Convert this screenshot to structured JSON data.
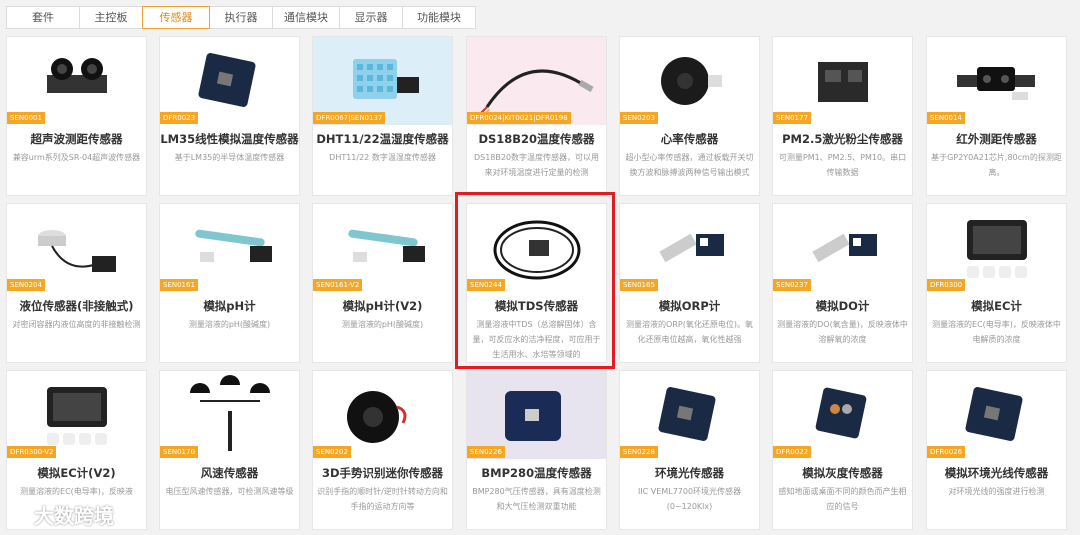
{
  "tabs": [
    {
      "label": "套件",
      "active": false
    },
    {
      "label": "主控板",
      "active": false
    },
    {
      "label": "传感器",
      "active": true
    },
    {
      "label": "执行器",
      "active": false
    },
    {
      "label": "通信模块",
      "active": false
    },
    {
      "label": "显示器",
      "active": false
    },
    {
      "label": "功能模块",
      "active": false
    }
  ],
  "colors": {
    "accent": "#f5a623",
    "highlight": "#e31b23"
  },
  "products": [
    {
      "sku": "SEN0001",
      "title": "超声波测距传感器",
      "desc": "兼容urm系列及SR-04超声波传感器",
      "icon": "ultrasonic-sensor-icon"
    },
    {
      "sku": "DFR0023",
      "title": "LM35线性模拟温度传感器",
      "desc": "基于LM35的半导体温度传感器",
      "icon": "temperature-module-icon"
    },
    {
      "sku": "DFR0067|SEN0137",
      "title": "DHT11/22温湿度传感器",
      "desc": "DHT11/22 数字温湿度传感器",
      "icon": "humidity-sensor-icon"
    },
    {
      "sku": "DFR0024|KIT0021|DFR0198",
      "title": "DS18B20温度传感器",
      "desc": "DS18B20数字温度传感器，可以用来对环境温度进行定量的检测",
      "icon": "probe-cable-icon"
    },
    {
      "sku": "SEN0203",
      "title": "心率传感器",
      "desc": "超小型心率传感器，通过板载开关切换方波和脉搏波两种信号输出模式",
      "icon": "heart-rate-sensor-icon"
    },
    {
      "sku": "SEN0177",
      "title": "PM2.5激光粉尘传感器",
      "desc": "可测量PM1、PM2.5、PM10。串口传输数据",
      "icon": "dust-sensor-icon"
    },
    {
      "sku": "SEN0014",
      "title": "红外测距传感器",
      "desc": "基于GP2Y0A21芯片,80cm的探测距离。",
      "icon": "ir-distance-sensor-icon"
    },
    {
      "sku": "SEN0204",
      "title": "液位传感器(非接触式)",
      "desc": "对密闭容器内液位高度的非接触检测",
      "icon": "liquid-level-sensor-icon"
    },
    {
      "sku": "SEN0161",
      "title": "模拟pH计",
      "desc": "测量溶液的pH(酸碱度)",
      "icon": "ph-probe-icon"
    },
    {
      "sku": "SEN0161-V2",
      "title": "模拟pH计(V2)",
      "desc": "测量溶液的pH(酸碱度)",
      "icon": "ph-probe-v2-icon"
    },
    {
      "sku": "SEN0244",
      "title": "模拟TDS传感器",
      "desc": "测量溶液中TDS（总溶解固体）含量，可反应水的洁净程度，可应用于生活用水、水培等领域的",
      "icon": "tds-probe-icon"
    },
    {
      "sku": "SEN0165",
      "title": "模拟ORP计",
      "desc": "测量溶液的ORP(氧化还原电位)。氧化还原电位越高，氧化性越强",
      "icon": "orp-probe-icon"
    },
    {
      "sku": "SEN0237",
      "title": "模拟DO计",
      "desc": "测量溶液的DO(氧含量)，反映液体中溶解氧的浓度",
      "icon": "do-probe-icon"
    },
    {
      "sku": "DFR0300",
      "title": "模拟EC计",
      "desc": "测量溶液的EC(电导率)，反映液体中电解质的浓度",
      "icon": "ec-meter-kit-icon"
    },
    {
      "sku": "DFR0300-V2",
      "title": "模拟EC计(V2)",
      "desc": "测量溶液的EC(电导率)，反映液",
      "icon": "ec-meter-kit-v2-icon"
    },
    {
      "sku": "SEN0170",
      "title": "风速传感器",
      "desc": "电压型风速传感器，可检测风速等级",
      "icon": "anemometer-icon"
    },
    {
      "sku": "SEN0202",
      "title": "3D手势识别迷你传感器",
      "desc": "识别手指的顺时针/逆时针转动方向和手指的运动方向等",
      "icon": "gesture-sensor-icon"
    },
    {
      "sku": "SEN0226",
      "title": "BMP280温度传感器",
      "desc": "BMP280气压传感器，具有温度检测和大气压检测双重功能",
      "icon": "bmp280-board-icon"
    },
    {
      "sku": "SEN0228",
      "title": "环境光传感器",
      "desc": "IIC VEML7700环境光传感器(0~120Klx)",
      "icon": "ambient-light-sensor-icon"
    },
    {
      "sku": "DFR0022",
      "title": "模拟灰度传感器",
      "desc": "感知地面或桌面不同的颜色而产生相应的信号",
      "icon": "grayscale-sensor-icon"
    },
    {
      "sku": "DFR0026",
      "title": "模拟环境光线传感器",
      "desc": "对环境光线的强度进行检测",
      "icon": "light-sensor-icon"
    }
  ],
  "watermark": "大数跨境"
}
